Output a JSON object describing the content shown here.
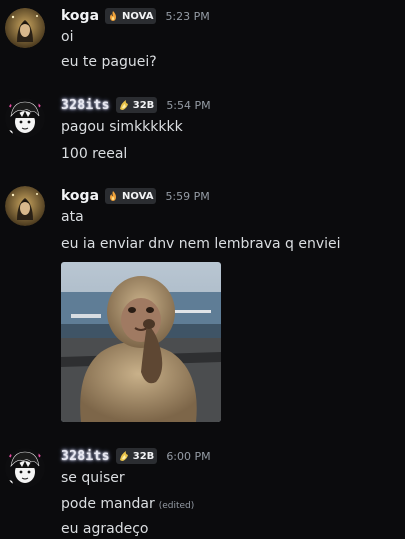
{
  "messages": [
    {
      "author": "koga",
      "badge": {
        "icon": "fire-icon",
        "label": "NOVA"
      },
      "time": "5:23 PM",
      "lines": [
        "oi",
        "eu te paguei?"
      ]
    },
    {
      "author": "328its",
      "badge": {
        "icon": "flame-gold-icon",
        "label": "32B"
      },
      "time": "5:54 PM",
      "lines": [
        "pagou simkkkkkk",
        "100 reeal"
      ]
    },
    {
      "author": "koga",
      "badge": {
        "icon": "fire-icon",
        "label": "NOVA"
      },
      "time": "5:59 PM",
      "lines": [
        "ata",
        "eu ia enviar dnv nem lembrava q enviei"
      ],
      "attachment": "monkey-thinking-image"
    },
    {
      "author": "328its",
      "badge": {
        "icon": "flame-gold-icon",
        "label": "32B"
      },
      "time": "6:00 PM",
      "lines": [
        "se quiser",
        "pode mandar",
        "eu agradeço"
      ],
      "edited": "(edited)"
    }
  ],
  "colors": {
    "background": "#0b0b0d",
    "text": "#dbdee1",
    "muted": "#949ba4",
    "badge_bg": "#2b2d31"
  }
}
